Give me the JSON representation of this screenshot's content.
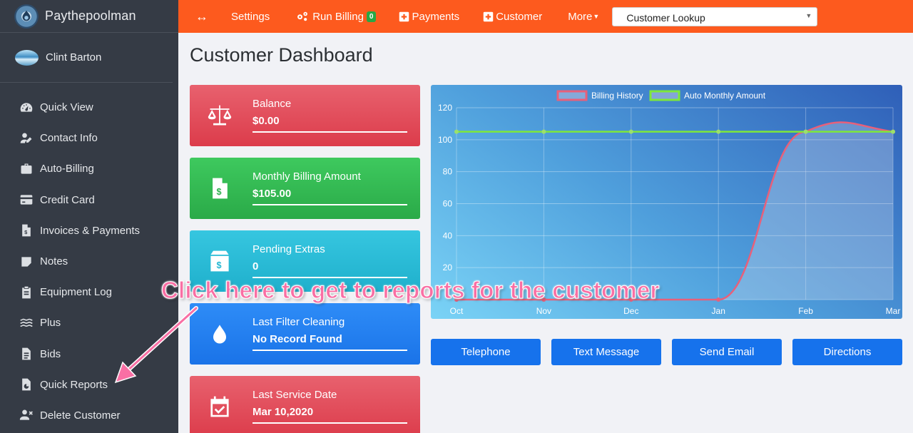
{
  "brand": {
    "name": "Paythepoolman"
  },
  "user": {
    "name": "Clint Barton"
  },
  "sidebar": {
    "items": [
      {
        "label": "Quick View",
        "icon": "gauge-icon"
      },
      {
        "label": "Contact Info",
        "icon": "user-edit-icon"
      },
      {
        "label": "Auto-Billing",
        "icon": "suitcase-icon"
      },
      {
        "label": "Credit Card",
        "icon": "credit-card-icon"
      },
      {
        "label": "Invoices & Payments",
        "icon": "invoice-icon"
      },
      {
        "label": "Notes",
        "icon": "sticky-note-icon"
      },
      {
        "label": "Equipment Log",
        "icon": "clipboard-icon"
      },
      {
        "label": "Plus",
        "icon": "water-icon"
      },
      {
        "label": "Bids",
        "icon": "document-icon"
      },
      {
        "label": "Quick Reports",
        "icon": "report-icon"
      },
      {
        "label": "Delete Customer",
        "icon": "user-times-icon"
      }
    ]
  },
  "topbar": {
    "toggle": "↔",
    "settings": "Settings",
    "run_billing": "Run Billing",
    "run_billing_count": "0",
    "payments": "Payments",
    "customer": "Customer",
    "more": "More",
    "lookup": "Customer Lookup"
  },
  "page": {
    "title": "Customer Dashboard"
  },
  "cards": [
    {
      "title": "Balance",
      "value": "$0.00",
      "icon": "balance-scale-icon",
      "color": "#dc3c4b"
    },
    {
      "title": "Monthly Billing Amount",
      "value": "$105.00",
      "icon": "invoice-dollar-icon",
      "color": "#2aaa48"
    },
    {
      "title": "Pending Extras",
      "value": "0",
      "icon": "box-dollar-icon",
      "color": "#1fb0cc"
    },
    {
      "title": "Last Filter Cleaning",
      "value": "No Record Found",
      "icon": "water-drop-icon",
      "color": "#1a73e8"
    },
    {
      "title": "Last Service Date",
      "value": "Mar 10,2020",
      "icon": "calendar-check-icon",
      "color": "#dc3c4b"
    }
  ],
  "chart_data": {
    "type": "line",
    "categories": [
      "Oct",
      "Nov",
      "Dec",
      "Jan",
      "Feb",
      "Mar"
    ],
    "series": [
      {
        "name": "Billing History",
        "values": [
          0,
          0,
          0,
          0,
          105,
          105
        ],
        "color": "#e8607a"
      },
      {
        "name": "Auto Monthly Amount",
        "values": [
          105,
          105,
          105,
          105,
          105,
          105
        ],
        "color": "#7ee83a"
      }
    ],
    "yticks": [
      20,
      40,
      60,
      80,
      100,
      120
    ],
    "ylim": [
      0,
      120
    ],
    "grid": true,
    "legend": "top-center"
  },
  "actions": {
    "telephone": "Telephone",
    "text_message": "Text Message",
    "send_email": "Send Email",
    "directions": "Directions"
  },
  "annotation": {
    "text": "Click here to get to reports for the customer",
    "color": "#f96fa4"
  }
}
